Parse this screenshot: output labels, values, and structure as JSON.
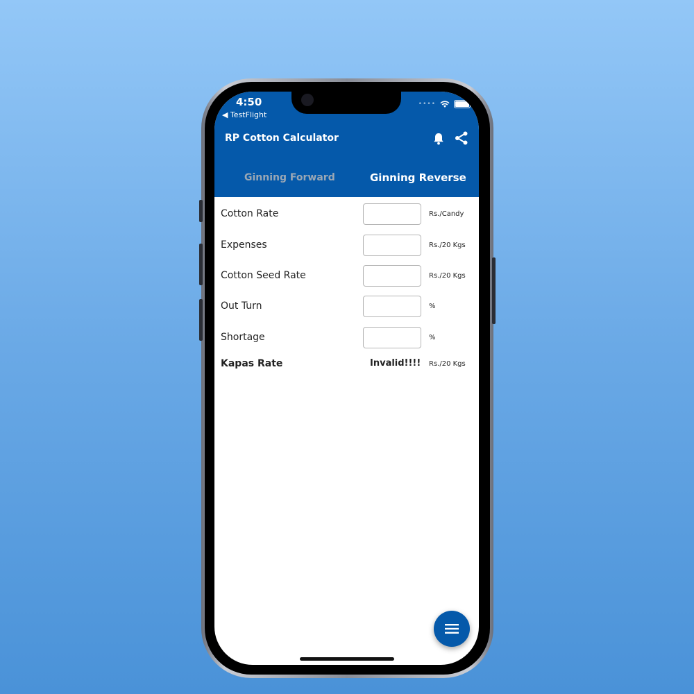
{
  "status_bar": {
    "time": "4:50",
    "back_label": "◀ TestFlight"
  },
  "app_bar": {
    "title": "RP Cotton Calculator",
    "icons": [
      "bell-icon",
      "share-icon"
    ]
  },
  "tabs": [
    {
      "label": "Ginning Forward",
      "active": false
    },
    {
      "label": "Ginning Reverse",
      "active": true
    }
  ],
  "form": {
    "rows": [
      {
        "label": "Cotton Rate",
        "value": "",
        "unit": "Rs./Candy"
      },
      {
        "label": "Expenses",
        "value": "",
        "unit": "Rs./20 Kgs"
      },
      {
        "label": "Cotton Seed Rate",
        "value": "",
        "unit": "Rs./20 Kgs"
      },
      {
        "label": "Out Turn",
        "value": "",
        "unit": "%"
      },
      {
        "label": "Shortage",
        "value": "",
        "unit": "%"
      }
    ],
    "result": {
      "label": "Kapas Rate",
      "value": "Invalid!!!!",
      "unit": "Rs./20 Kgs"
    }
  },
  "fab": {
    "icon": "menu-icon"
  },
  "colors": {
    "primary": "#0559aa",
    "tab_inactive": "#9aa7b5",
    "background_top": "#93c7f7",
    "background_bottom": "#4a92d8"
  }
}
